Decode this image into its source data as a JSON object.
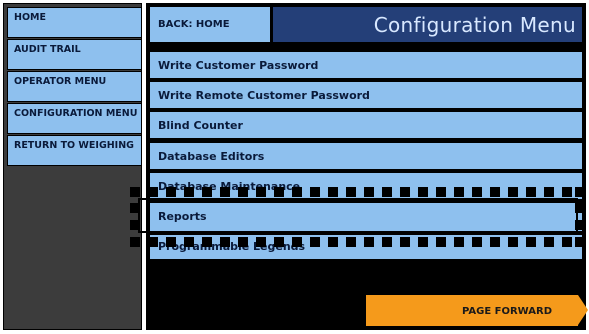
{
  "sidebar": {
    "items": [
      {
        "label": "HOME"
      },
      {
        "label": "AUDIT TRAIL"
      },
      {
        "label": "OPERATOR MENU"
      },
      {
        "label": "CONFIGURATION MENU"
      },
      {
        "label": "RETURN TO WEIGHING"
      }
    ]
  },
  "header": {
    "back_label": "BACK: HOME",
    "title": "Configuration Menu"
  },
  "menu": {
    "items": [
      {
        "label": "Write Customer Password"
      },
      {
        "label": "Write Remote Customer Password"
      },
      {
        "label": "Blind Counter"
      },
      {
        "label": "Database Editors"
      },
      {
        "label": "Database Maintenance"
      },
      {
        "label": "Reports"
      },
      {
        "label": "Programmable Legends"
      }
    ]
  },
  "footer": {
    "page_forward_label": "PAGE FORWARD"
  },
  "colors": {
    "button_blue": "#8ec0ee",
    "title_blue": "#243f78",
    "accent_orange": "#f59a1b"
  }
}
